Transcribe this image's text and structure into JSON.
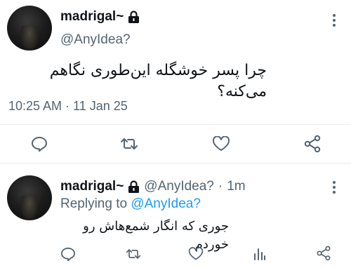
{
  "main_tweet": {
    "display_name": "madrigal~",
    "handle": "@AnyIdea?",
    "text": "چرا پسر خوشگله این‌طوری نگاهم می‌کنه؟",
    "timestamp": "10:25 AM · 11 Jan 25"
  },
  "reply": {
    "display_name": "madrigal~",
    "handle": "@AnyIdea?",
    "separator": "·",
    "age": "1m",
    "replying_prefix": "Replying to",
    "replying_handle": "@AnyIdea?",
    "text": "جوری که انگار شمع‌هاش رو خوردم"
  },
  "icons": {
    "lock": "lock-icon",
    "more": "more-vertical-icon",
    "reply": "reply-icon",
    "retweet": "retweet-icon",
    "like": "heart-icon",
    "share": "share-icon",
    "views": "views-icon"
  },
  "colors": {
    "text": "#0f1419",
    "secondary": "#536471",
    "link": "#1d9bf0",
    "divider": "#e6ecf0"
  }
}
